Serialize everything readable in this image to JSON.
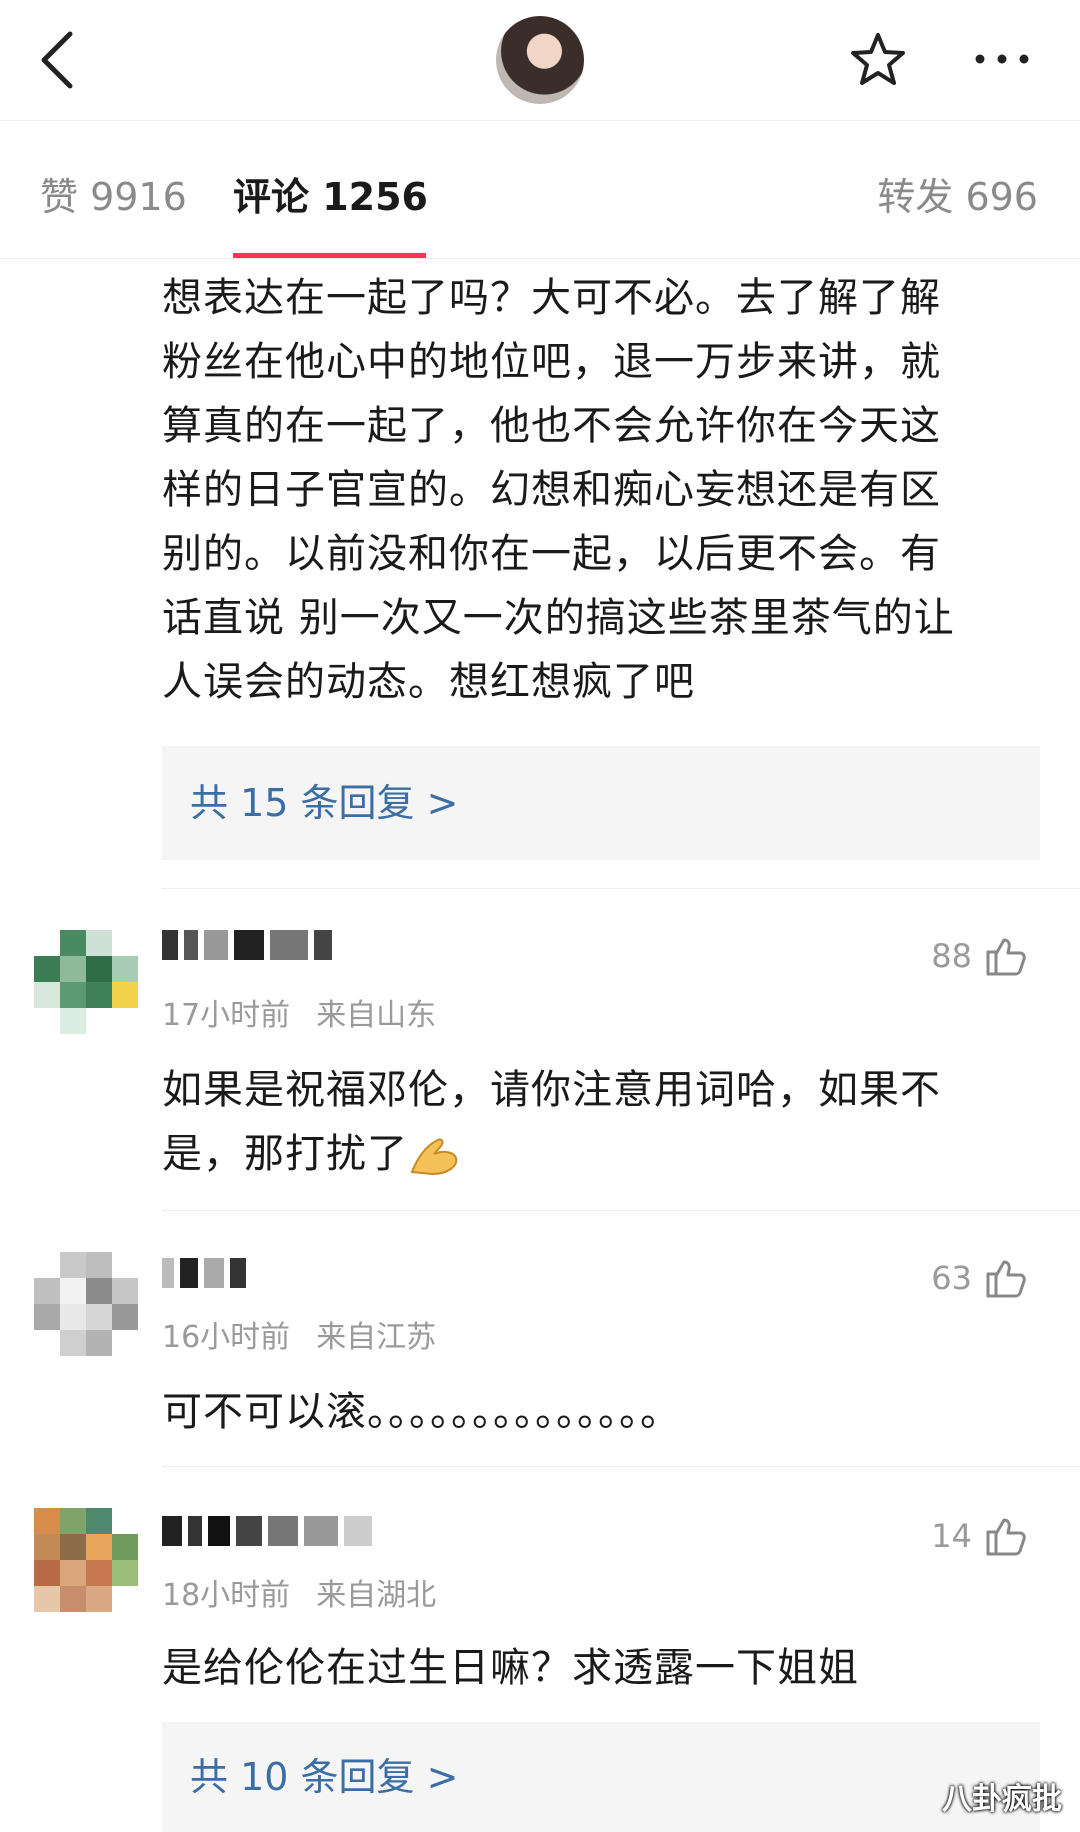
{
  "header": {
    "back_icon": "chevron-left-icon",
    "star_icon": "star-outline-icon",
    "more_icon": "more-dots-icon"
  },
  "tabs": {
    "likes": "赞 9916",
    "comments": "评论 1256",
    "reposts": "转发 696",
    "active": "comments"
  },
  "comments": [
    {
      "text": "想表达在一起了吗？大可不必。去了解了解粉丝在他心中的地位吧，退一万步来讲，就算真的在一起了，他也不会允许你在今天这样的日子官宣的。幻想和痴心妄想还是有区别的。以前没和你在一起，以后更不会。有话直说 别一次又一次的搞这些茶里茶气的让人误会的动态。想红想疯了吧",
      "lines": [
        "想表达在一起了吗？大可不必。去了解了解",
        "粉丝在他心中的地位吧，退一万步来讲，就",
        "算真的在一起了，他也不会允许你在今天这",
        "样的日子官宣的。幻想和痴心妄想还是有区",
        "别的。以前没和你在一起，以后更不会。有",
        "话直说 别一次又一次的搞这些茶里茶气的让",
        "人误会的动态。想红想疯了吧"
      ],
      "replies": "共 15 条回复 >"
    },
    {
      "time": "17小时前",
      "location": "来自山东",
      "likes": "88",
      "lines": [
        "如果是祝福邓伦，请你注意用词哈，如果不",
        "是，那打扰了"
      ],
      "emoji": "hands-together-emoji"
    },
    {
      "time": "16小时前",
      "location": "来自江苏",
      "likes": "63",
      "lines": [
        "可不可以滚。。。。。。。。。。。。。。"
      ]
    },
    {
      "time": "18小时前",
      "location": "来自湖北",
      "likes": "14",
      "lines": [
        "是给伦伦在过生日嘛？求透露一下姐姐"
      ],
      "replies": "共 10 条回复 >"
    }
  ],
  "watermark": "八卦疯批",
  "colors": {
    "accent": "#ff3355",
    "link": "#3b6ea5",
    "muted": "#9a9a9a"
  }
}
